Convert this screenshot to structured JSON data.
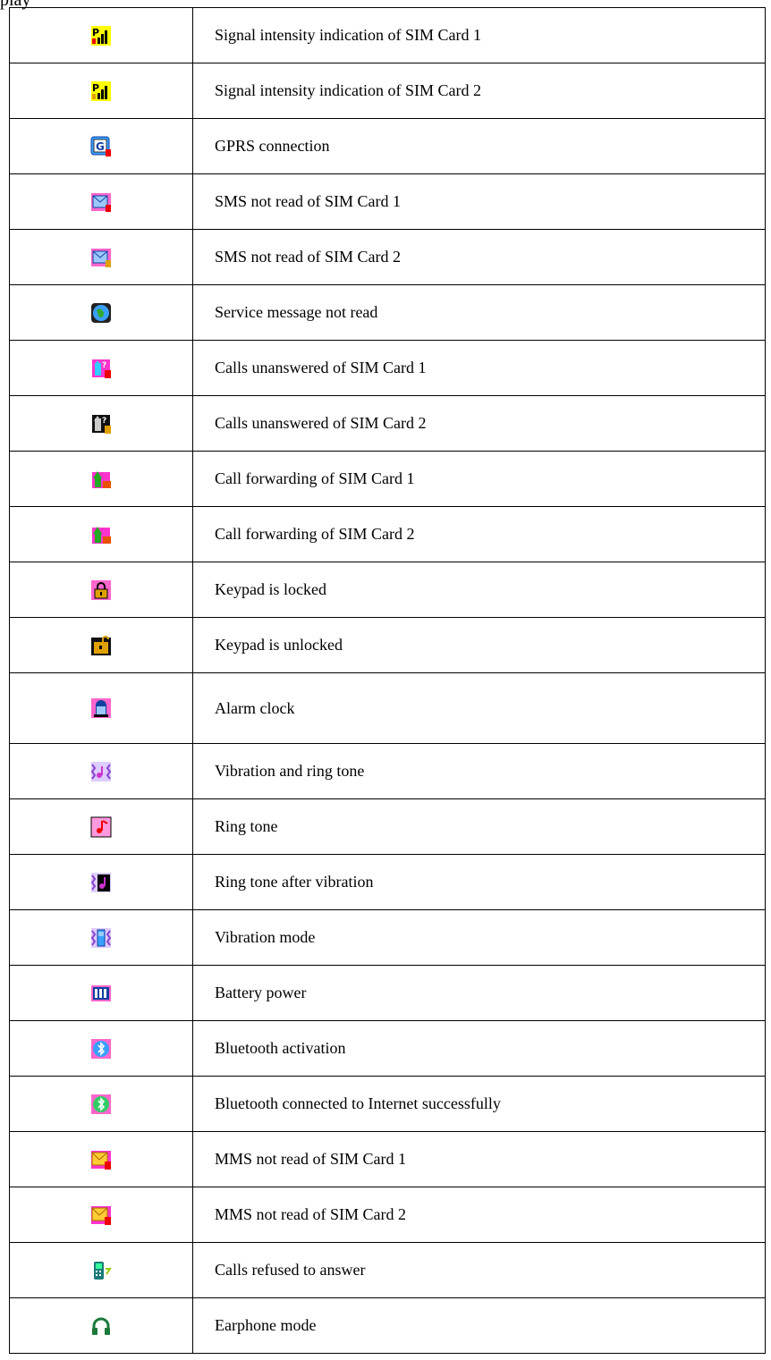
{
  "top_fragment": "play",
  "rows": [
    {
      "icon": "signal-sim1-icon",
      "label": "Signal intensity indication of SIM Card 1"
    },
    {
      "icon": "signal-sim2-icon",
      "label": "Signal intensity indication of SIM Card 2"
    },
    {
      "icon": "gprs-icon",
      "label": "GPRS connection"
    },
    {
      "icon": "sms-sim1-icon",
      "label": "SMS not read of SIM Card 1"
    },
    {
      "icon": "sms-sim2-icon",
      "label": "SMS not read of SIM Card 2"
    },
    {
      "icon": "service-message-icon",
      "label": "Service message not read"
    },
    {
      "icon": "missed-call-sim1-icon",
      "label": "Calls unanswered of SIM Card 1"
    },
    {
      "icon": "missed-call-sim2-icon",
      "label": "Calls unanswered of SIM Card 2"
    },
    {
      "icon": "call-forward-sim1-icon",
      "label": "Call forwarding of SIM Card 1"
    },
    {
      "icon": "call-forward-sim2-icon",
      "label": "Call forwarding of SIM Card 2"
    },
    {
      "icon": "keypad-locked-icon",
      "label": "Keypad is locked"
    },
    {
      "icon": "keypad-unlocked-icon",
      "label": "Keypad is unlocked"
    },
    {
      "icon": "alarm-clock-icon",
      "label": "Alarm clock"
    },
    {
      "icon": "vibration-ring-icon",
      "label": "Vibration and ring tone"
    },
    {
      "icon": "ring-tone-icon",
      "label": "Ring tone"
    },
    {
      "icon": "ring-after-vibration-icon",
      "label": "Ring tone after vibration"
    },
    {
      "icon": "vibration-mode-icon",
      "label": "Vibration mode"
    },
    {
      "icon": "battery-icon",
      "label": "Battery power"
    },
    {
      "icon": "bluetooth-icon",
      "label": "Bluetooth activation"
    },
    {
      "icon": "bluetooth-internet-icon",
      "label": "Bluetooth connected to Internet successfully"
    },
    {
      "icon": "mms-sim1-icon",
      "label": "MMS not read of SIM Card 1"
    },
    {
      "icon": "mms-sim2-icon",
      "label": "MMS not read of SIM Card 2"
    },
    {
      "icon": "calls-refused-icon",
      "label": "Calls refused to answer"
    },
    {
      "icon": "earphone-icon",
      "label": "Earphone mode"
    }
  ]
}
